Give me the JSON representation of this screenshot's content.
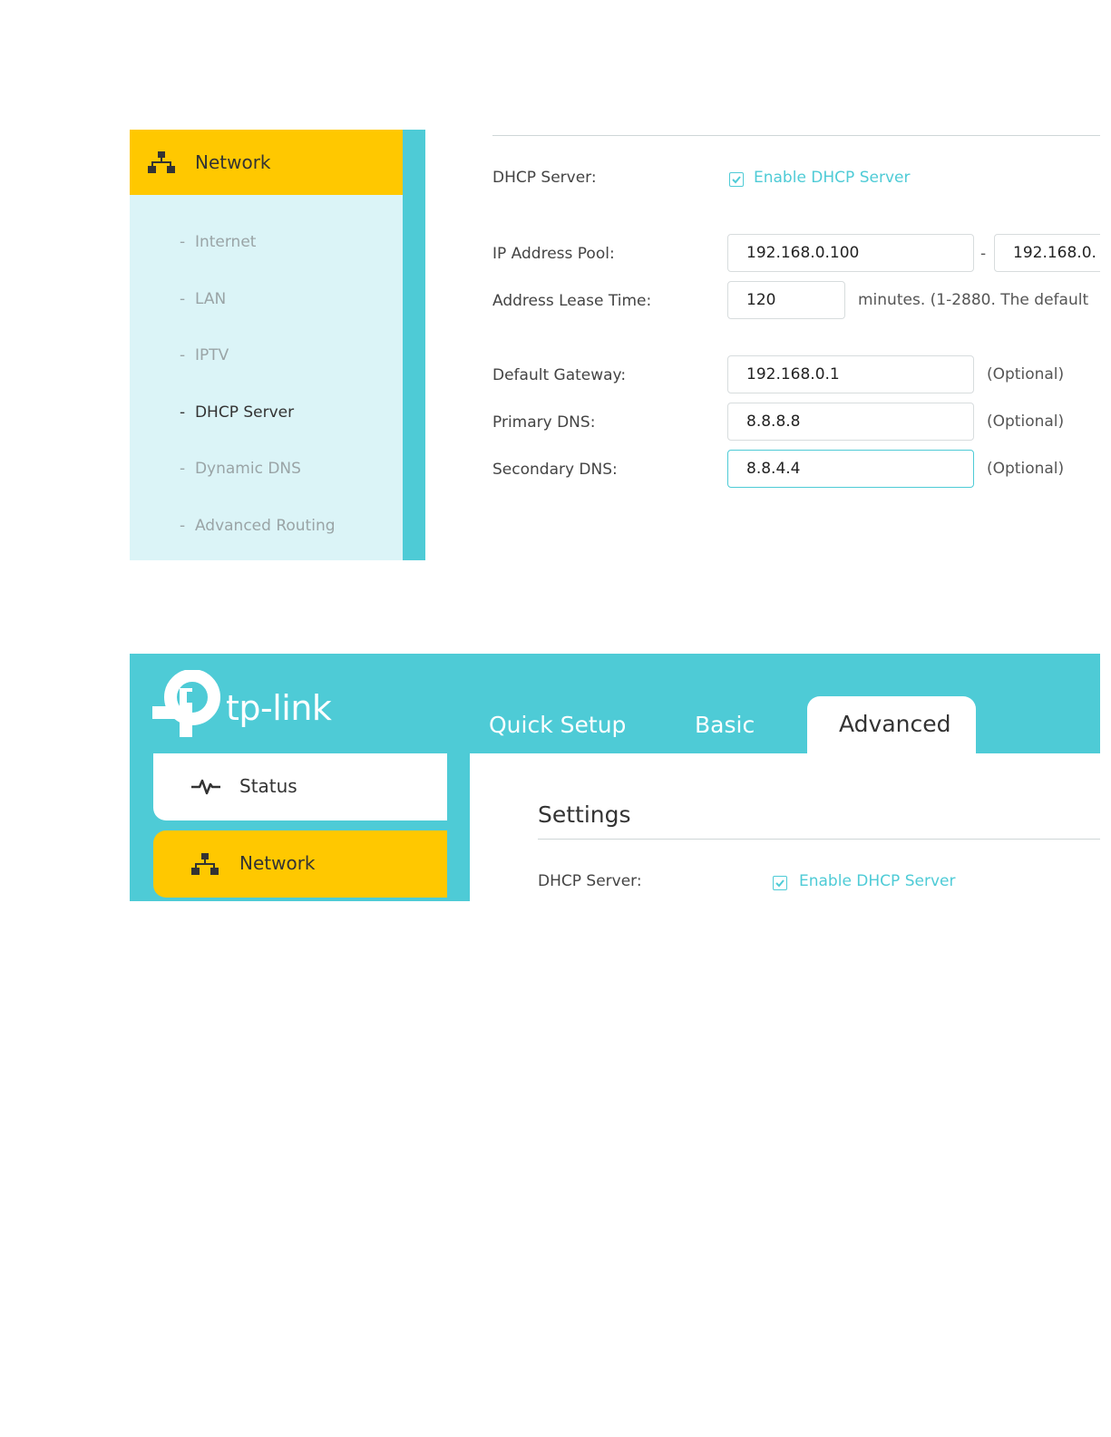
{
  "screenshot1": {
    "sidebar": {
      "header_label": "Network",
      "items": [
        {
          "label": "Internet",
          "active": false
        },
        {
          "label": "LAN",
          "active": false
        },
        {
          "label": "IPTV",
          "active": false
        },
        {
          "label": "DHCP Server",
          "active": true
        },
        {
          "label": "Dynamic DNS",
          "active": false
        },
        {
          "label": "Advanced Routing",
          "active": false
        }
      ],
      "dash": "-"
    },
    "form": {
      "dhcp_server_label": "DHCP Server:",
      "enable_label": "Enable DHCP Server",
      "enable_checked": true,
      "ip_pool_label": "IP Address Pool:",
      "ip_pool_start": "192.168.0.100",
      "ip_pool_sep": "-",
      "ip_pool_end": "192.168.0.",
      "lease_label": "Address Lease Time:",
      "lease_value": "120",
      "lease_note": "minutes. (1-2880. The default",
      "gateway_label": "Default Gateway:",
      "gateway_value": "192.168.0.1",
      "primary_dns_label": "Primary DNS:",
      "primary_dns_value": "8.8.8.8",
      "secondary_dns_label": "Secondary DNS:",
      "secondary_dns_value": "8.8.4.4",
      "optional": "(Optional)"
    }
  },
  "screenshot2": {
    "brand": "tp-link",
    "tabs": [
      {
        "label": "Quick Setup",
        "active": false
      },
      {
        "label": "Basic",
        "active": false
      },
      {
        "label": "Advanced",
        "active": true
      }
    ],
    "sidebar": {
      "status_label": "Status",
      "network_label": "Network"
    },
    "main": {
      "section_title": "Settings",
      "dhcp_server_label": "DHCP Server:",
      "enable_label": "Enable DHCP Server",
      "enable_checked": true
    }
  },
  "colors": {
    "accent": "#4ecbd6",
    "highlight": "#ffc800",
    "subnav_bg": "#dbf4f7"
  }
}
